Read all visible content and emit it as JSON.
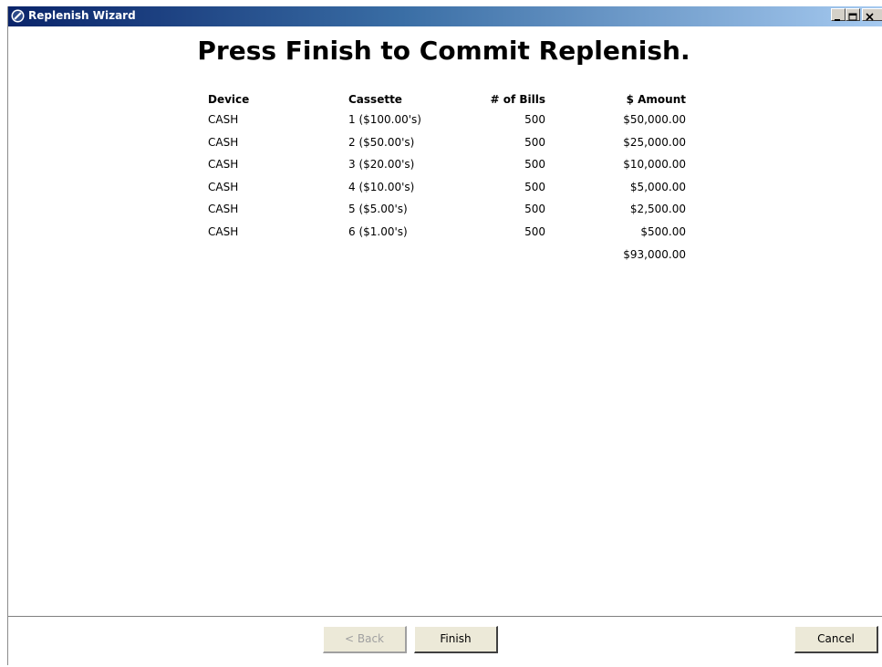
{
  "window": {
    "title": "Replenish Wizard",
    "icon": "app-logo-icon",
    "controls": {
      "minimize": "_",
      "maximize": "□",
      "close": "✕"
    }
  },
  "main": {
    "heading": "Press Finish to Commit Replenish.",
    "table": {
      "headers": [
        "Device",
        "Cassette",
        "# of Bills",
        "$ Amount"
      ],
      "rows": [
        [
          "CASH",
          "1 ($100.00's)",
          "500",
          "$50,000.00"
        ],
        [
          "CASH",
          "2 ($50.00's)",
          "500",
          "$25,000.00"
        ],
        [
          "CASH",
          "3 ($20.00's)",
          "500",
          "$10,000.00"
        ],
        [
          "CASH",
          "4 ($10.00's)",
          "500",
          "$5,000.00"
        ],
        [
          "CASH",
          "5 ($5.00's)",
          "500",
          "$2,500.00"
        ],
        [
          "CASH",
          "6 ($1.00's)",
          "500",
          "$500.00"
        ]
      ],
      "total": "$93,000.00"
    }
  },
  "footer": {
    "back_label": "< Back",
    "finish_label": "Finish",
    "cancel_label": "Cancel"
  }
}
